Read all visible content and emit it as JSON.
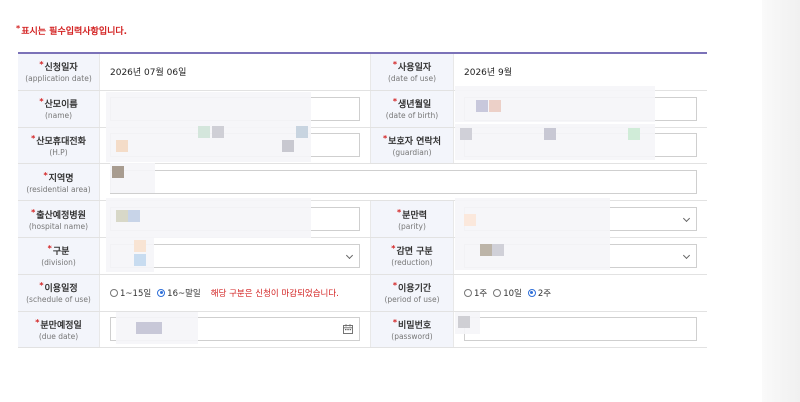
{
  "notice": "표시는 필수입력사항입니다.",
  "rows": {
    "application_date": {
      "label": "신청일자",
      "en": "(application date)",
      "value": "2026년 07월 06일"
    },
    "date_of_use": {
      "label": "사용일자",
      "en": "(date of use)",
      "value": "2026년 9월"
    },
    "name": {
      "label": "산모이름",
      "en": "(name)"
    },
    "date_of_birth": {
      "label": "생년월일",
      "en": "(date of birth)"
    },
    "hp": {
      "label": "산모휴대전화",
      "en": "(H.P)"
    },
    "guardian": {
      "label": "보호자 연락처",
      "en": "(guardian)"
    },
    "residential_area": {
      "label": "지역명",
      "en": "(residential area)"
    },
    "hospital_name": {
      "label": "출산예정병원",
      "en": "(hospital name)"
    },
    "parity": {
      "label": "분만력",
      "en": "(parity)"
    },
    "division": {
      "label": "구분",
      "en": "(division)"
    },
    "reduction": {
      "label": "감면 구분",
      "en": "(reduction)"
    },
    "schedule_of_use": {
      "label": "이용일정",
      "en": "(schedule of use)",
      "options": [
        "1~15일",
        "16~말일"
      ],
      "selected": 1,
      "closed_message": "해당 구분은 신청이 마감되었습니다."
    },
    "period_of_use": {
      "label": "이용기간",
      "en": "(period of use)",
      "options": [
        "1주",
        "10일",
        "2주"
      ],
      "selected": 2
    },
    "due_date": {
      "label": "분만예정일",
      "en": "(due date)"
    },
    "password": {
      "label": "비밀번호",
      "en": "(password)"
    }
  },
  "colors": {
    "accent_line": "#7b72b8",
    "required": "#d32222",
    "label_bg": "#f3f5fb",
    "radio_on": "#2f6fd8"
  }
}
